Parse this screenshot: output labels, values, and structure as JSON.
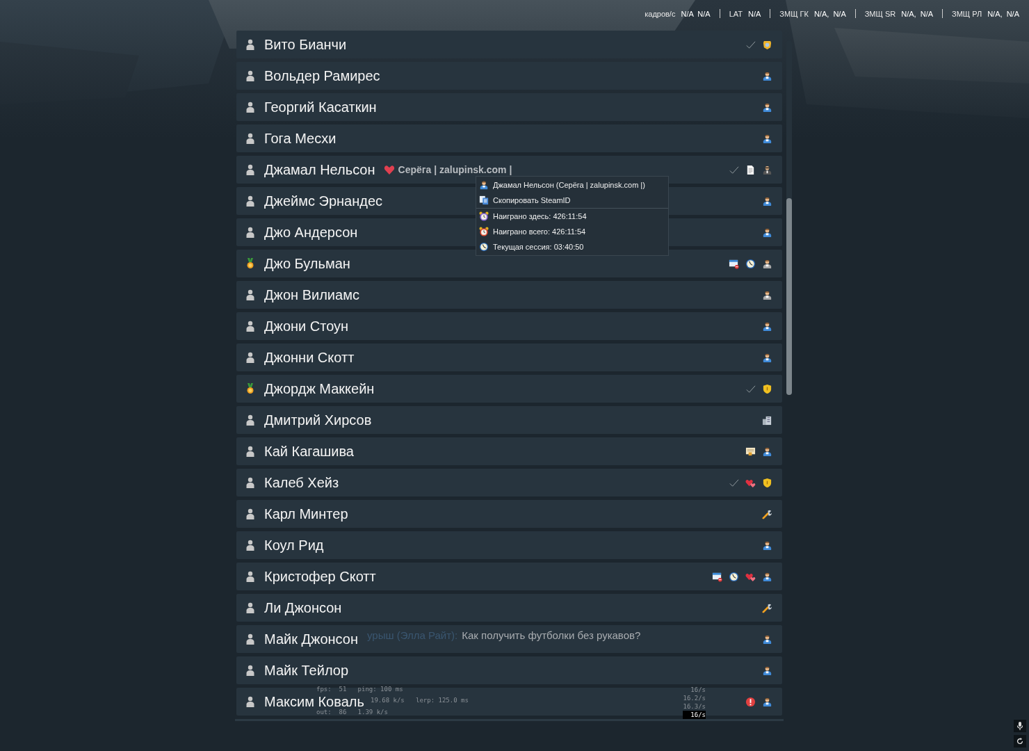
{
  "stats": [
    {
      "label": "кадров/с",
      "value": "N/A  N/A"
    },
    {
      "label": "LAT",
      "value": "N/A"
    },
    {
      "label": "ЗМЩ ГК",
      "value": "N/A,  N/A"
    },
    {
      "label": "ЗМЩ SR",
      "value": "N/A,  N/A"
    },
    {
      "label": "ЗМЩ РЛ",
      "value": "N/A,  N/A"
    }
  ],
  "scoreboard": {
    "rows": [
      {
        "rank": {
          "kind": "person"
        },
        "name": "Вито Бианчи",
        "icons": [
          {
            "kind": "check"
          },
          {
            "kind": "badge"
          }
        ]
      },
      {
        "rank": {
          "kind": "person"
        },
        "name": "Вольдер Рамирес",
        "icons": [
          {
            "kind": "user"
          }
        ]
      },
      {
        "rank": {
          "kind": "person"
        },
        "name": "Георгий Касаткин",
        "icons": [
          {
            "kind": "user"
          }
        ]
      },
      {
        "rank": {
          "kind": "person"
        },
        "name": "Гога Месхи",
        "icons": [
          {
            "kind": "user"
          }
        ]
      },
      {
        "rank": {
          "kind": "person"
        },
        "name": "Джамал Нельсон",
        "tag": "Серёга | zalupinsk.com |",
        "icons": [
          {
            "kind": "check"
          },
          {
            "kind": "document"
          },
          {
            "kind": "agent"
          }
        ]
      },
      {
        "rank": {
          "kind": "person"
        },
        "name": "Джеймс Эрнандес",
        "icons": [
          {
            "kind": "user"
          }
        ]
      },
      {
        "rank": {
          "kind": "person"
        },
        "name": "Джо Андерсон",
        "icons": [
          {
            "kind": "user"
          }
        ]
      },
      {
        "rank": {
          "kind": "medal"
        },
        "name": "Джо Бульман",
        "icons": [
          {
            "kind": "calendar"
          },
          {
            "kind": "clock"
          },
          {
            "kind": "user-grey"
          }
        ]
      },
      {
        "rank": {
          "kind": "person"
        },
        "name": "Джон Вилиамс",
        "icons": [
          {
            "kind": "user-grey"
          }
        ]
      },
      {
        "rank": {
          "kind": "person"
        },
        "name": "Джони Стоун",
        "icons": [
          {
            "kind": "user"
          }
        ]
      },
      {
        "rank": {
          "kind": "person"
        },
        "name": "Джонни Скотт",
        "icons": [
          {
            "kind": "user"
          }
        ]
      },
      {
        "rank": {
          "kind": "medal"
        },
        "name": "Джордж Маккейн",
        "icons": [
          {
            "kind": "check"
          },
          {
            "kind": "shield"
          }
        ]
      },
      {
        "rank": {
          "kind": "person"
        },
        "name": "Дмитрий Хирсов",
        "icons": [
          {
            "kind": "building"
          }
        ]
      },
      {
        "rank": {
          "kind": "person"
        },
        "name": "Кай Кагашива",
        "icons": [
          {
            "kind": "certificate"
          },
          {
            "kind": "user"
          }
        ]
      },
      {
        "rank": {
          "kind": "person"
        },
        "name": "Калеб Хейз",
        "icons": [
          {
            "kind": "check"
          },
          {
            "kind": "hearts"
          },
          {
            "kind": "shield"
          }
        ]
      },
      {
        "rank": {
          "kind": "person"
        },
        "name": "Карл Минтер",
        "icons": [
          {
            "kind": "wrench"
          }
        ]
      },
      {
        "rank": {
          "kind": "person"
        },
        "name": "Коул Рид",
        "icons": [
          {
            "kind": "user"
          }
        ]
      },
      {
        "rank": {
          "kind": "person"
        },
        "name": "Кристофер Скотт",
        "icons": [
          {
            "kind": "calendar"
          },
          {
            "kind": "clock"
          },
          {
            "kind": "hearts"
          },
          {
            "kind": "user"
          }
        ]
      },
      {
        "rank": {
          "kind": "person"
        },
        "name": "Ли Джонсон",
        "icons": [
          {
            "kind": "wrench"
          }
        ]
      },
      {
        "rank": {
          "kind": "person"
        },
        "name": "Майк Джонсон",
        "icons": [
          {
            "kind": "user"
          }
        ]
      },
      {
        "rank": {
          "kind": "person"
        },
        "name": "Майк Тейлор",
        "icons": [
          {
            "kind": "user"
          }
        ]
      },
      {
        "rank": {
          "kind": "person"
        },
        "name": "Максим Коваль",
        "icons": [
          {
            "kind": "alert"
          },
          {
            "kind": "user"
          }
        ]
      }
    ]
  },
  "context_menu": {
    "items": [
      {
        "kind": "user",
        "label": "Джамал Нельсон (Серёга | zalupinsk.com |)"
      },
      {
        "kind": "copy",
        "label": "Скопировать SteamID"
      },
      {
        "kind": "alarm-purple",
        "label": "Наиграно здесь: 426:11:54"
      },
      {
        "kind": "alarm-red",
        "label": "Наиграно всего: 426:11:54"
      },
      {
        "kind": "clock",
        "label": "Текущая сессия: 03:40:50"
      }
    ]
  },
  "chat": {
    "prefix": "урыш (Элла Райт):",
    "message": "Как получить футболки без рукавов?"
  },
  "netgraph": {
    "left": [
      "fps:  51   ping: 100 ms",
      "19.68 k/s   lerp: 125.0 ms",
      "out:  86   1.39 k/s"
    ],
    "right": [
      "16/s",
      "16.2/s",
      "16.3/s"
    ],
    "extra": "16/s"
  }
}
